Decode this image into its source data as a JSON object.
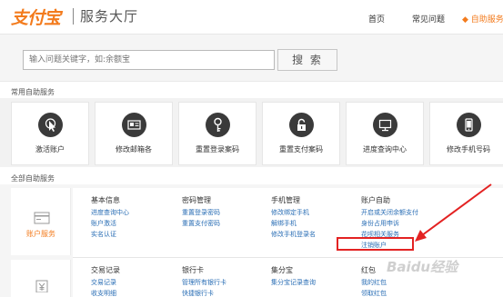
{
  "header": {
    "logo": "支付宝",
    "site_name": "服务大厅",
    "nav": {
      "home": "首页",
      "faq": "常见问题",
      "self_service": "◆ 自助服务"
    }
  },
  "search": {
    "placeholder": "输入问题关键字，如:余额宝",
    "button": "搜 索"
  },
  "sections": {
    "common": "常用自助服务",
    "all": "全部自助服务"
  },
  "tiles": [
    {
      "label": "激活账户",
      "icon": "cursor-click-icon"
    },
    {
      "label": "修改邮箱各",
      "icon": "id-card-icon"
    },
    {
      "label": "重置登录案码",
      "icon": "key-icon"
    },
    {
      "label": "重置支付案码",
      "icon": "lock-icon"
    },
    {
      "label": "进度查询中心",
      "icon": "monitor-icon"
    },
    {
      "label": "修改手机号码",
      "icon": "mobile-phone-icon"
    }
  ],
  "categories": {
    "account": {
      "label": "账户服务",
      "icon": "card-icon"
    },
    "trade": {
      "label": "",
      "icon": "yen-icon"
    }
  },
  "columns_row1": [
    {
      "head": "基本信息",
      "links": [
        "进度查询中心",
        "账户激活",
        "实名认证"
      ]
    },
    {
      "head": "密码管理",
      "links": [
        "重置登录密码",
        "重置支付密码"
      ]
    },
    {
      "head": "手机管理",
      "links": [
        "修改绑定手机",
        "解绑手机",
        "修改手机登录名"
      ]
    },
    {
      "head": "账户自助",
      "links": [
        "开启或关闭余额支付",
        "身份占用申诉",
        "花呗相关服务",
        "注销账户"
      ]
    }
  ],
  "columns_row2": [
    {
      "head": "交易记录",
      "links": [
        "交易记录",
        "收支明细"
      ]
    },
    {
      "head": "银行卡",
      "links": [
        "管理所有银行卡",
        "快捷银行卡"
      ]
    },
    {
      "head": "集分宝",
      "links": [
        "集分宝记录查询",
        ""
      ]
    },
    {
      "head": "红包",
      "links": [
        "我的红包",
        "领取红包"
      ]
    }
  ],
  "watermark": "Baidu经验",
  "colors": {
    "brand": "#f37b1d",
    "link": "#2a6eb5",
    "annotation": "#e32222"
  }
}
